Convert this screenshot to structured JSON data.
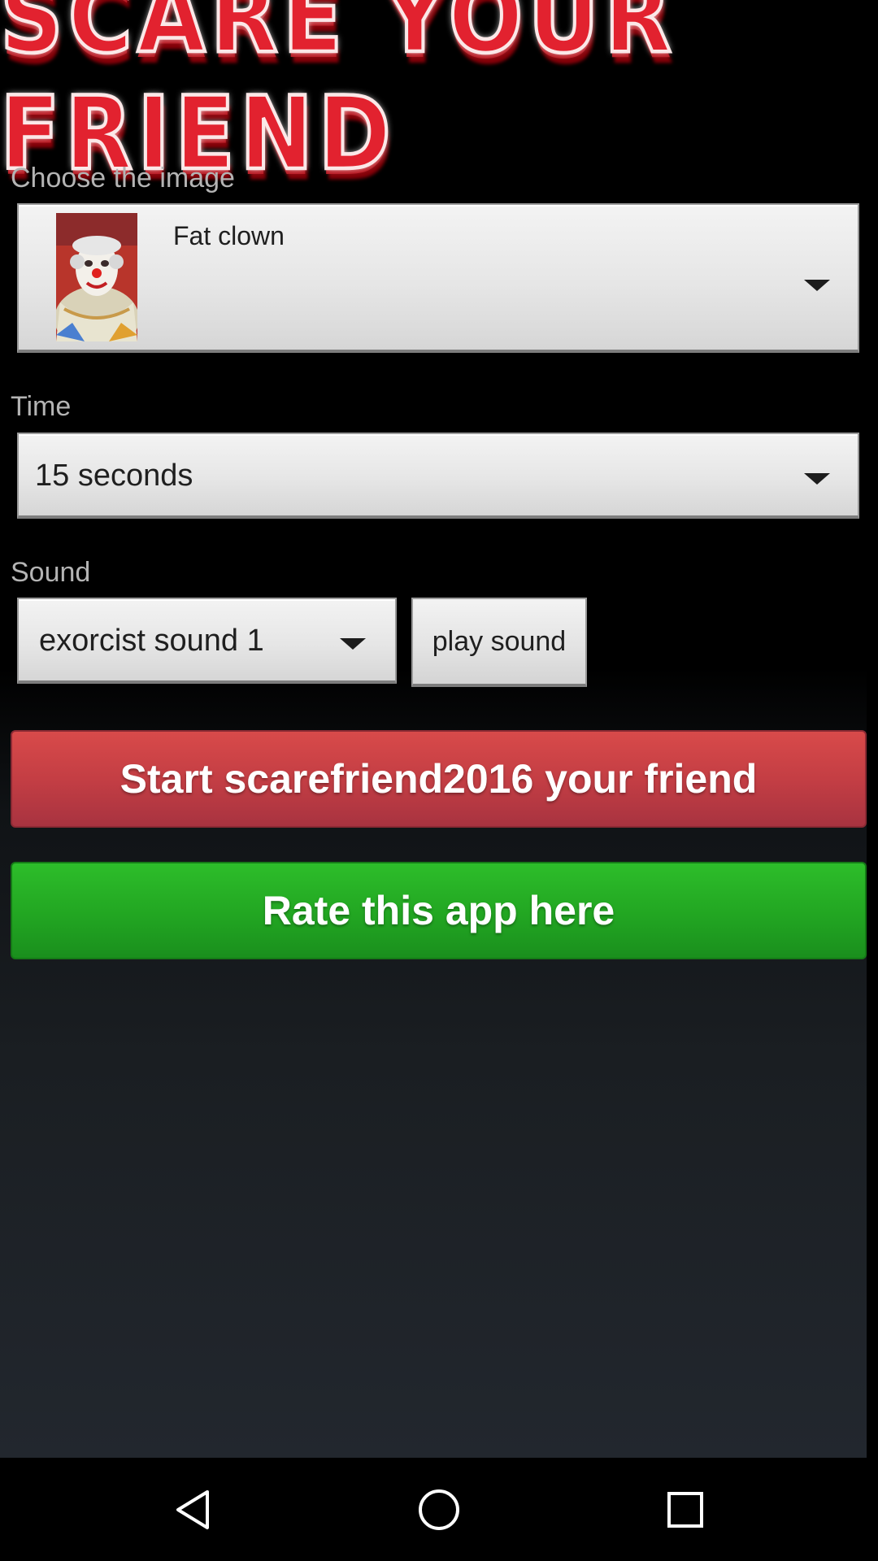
{
  "app": {
    "logo_text": "SCARE YOUR FRIEND"
  },
  "image_section": {
    "label": "Choose the image",
    "selected": "Fat clown",
    "thumbnail": "clown-portrait"
  },
  "time_section": {
    "label": "Time",
    "selected": "15 seconds"
  },
  "sound_section": {
    "label": "Sound",
    "selected": "exorcist sound 1",
    "play_button": "play sound"
  },
  "actions": {
    "start_label": "Start scarefriend2016 your friend",
    "rate_label": "Rate this app here"
  },
  "nav_bar": {
    "back": "back-icon",
    "home": "home-icon",
    "recents": "recents-icon"
  },
  "colors": {
    "start_button": "#c43e44",
    "rate_button": "#22a622",
    "logo": "#e2222f"
  }
}
